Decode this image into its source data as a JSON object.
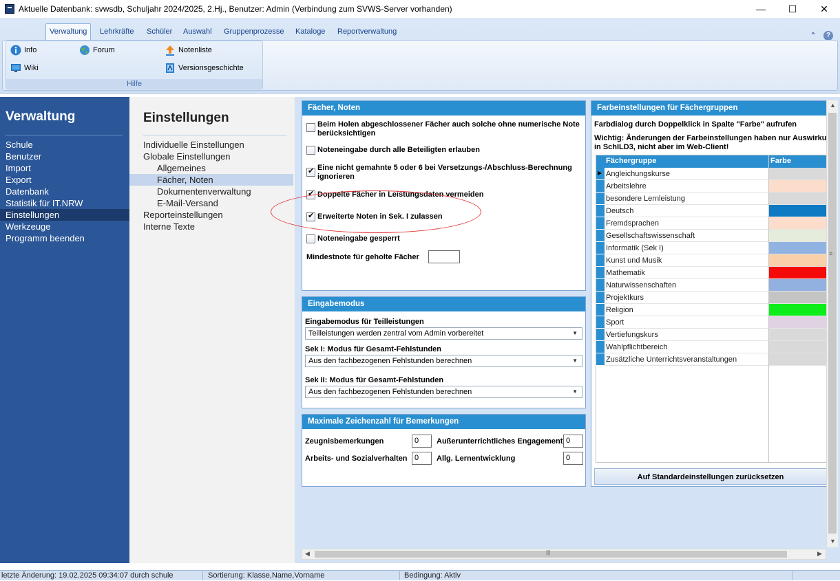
{
  "window": {
    "title": "Aktuelle Datenbank: svwsdb, Schuljahr 2024/2025, 2.Hj., Benutzer: Admin (Verbindung zum SVWS-Server vorhanden)",
    "minimize": "—",
    "maximize": "☐",
    "close": "✕"
  },
  "ribbon": {
    "tabs": [
      "Verwaltung",
      "Lehrkräfte",
      "Schüler",
      "Auswahl",
      "Gruppenprozesse",
      "Kataloge",
      "Reportverwaltung"
    ],
    "collapse": "⌃",
    "help": "?",
    "group_label": "Hilfe",
    "buttons": {
      "info": "Info",
      "forum": "Forum",
      "notenliste": "Notenliste",
      "wiki": "Wiki",
      "versionsgeschichte": "Versionsgeschichte"
    }
  },
  "leftnav": {
    "title": "Verwaltung",
    "items": [
      "Schule",
      "Benutzer",
      "Import",
      "Export",
      "Datenbank",
      "Statistik für IT.NRW",
      "Einstellungen",
      "Werkzeuge",
      "Programm beenden"
    ],
    "selected": "Einstellungen"
  },
  "settings": {
    "title": "Einstellungen",
    "items": [
      "Individuelle Einstellungen",
      "Globale Einstellungen",
      "Allgemeines",
      "Fächer, Noten",
      "Dokumentenverwaltung",
      "E-Mail-Versand",
      "Reporteinstellungen",
      "Interne Texte"
    ],
    "selected": "Fächer, Noten"
  },
  "faecher_noten": {
    "header": "Fächer, Noten",
    "checkboxes": [
      {
        "label_line1": "Beim Holen abgeschlossener Fächer auch solche ohne numerische Note",
        "label_line2": "berücksichtigen",
        "checked": false
      },
      {
        "label_line1": "Noteneingabe durch alle Beteiligten erlauben",
        "label_line2": "",
        "checked": false
      },
      {
        "label_line1": "Eine nicht gemahnte 5 oder 6 bei Versetzungs-/Abschluss-Berechnung",
        "label_line2": "ignorieren",
        "checked": true
      },
      {
        "label_line1": "Doppelte Fächer in Leistungsdaten vermeiden",
        "label_line2": "",
        "checked": true
      },
      {
        "label_line1": "Erweiterte Noten in Sek. I zulassen",
        "label_line2": "",
        "checked": true
      },
      {
        "label_line1": "Noteneingabe gesperrt",
        "label_line2": "",
        "checked": false
      }
    ],
    "mindestnote_label": "Mindestnote für geholte Fächer",
    "mindestnote_value": ""
  },
  "eingabemodus": {
    "header": "Eingabemodus",
    "teilleistungen_label": "Eingabemodus für Teilleistungen",
    "teilleistungen_value": "Teilleistungen werden zentral vom Admin vorbereitet",
    "sek1_label": "Sek I: Modus für Gesamt-Fehlstunden",
    "sek1_value": "Aus den fachbezogenen Fehlstunden berechnen",
    "sek2_label": "Sek II: Modus für Gesamt-Fehlstunden",
    "sek2_value": "Aus den fachbezogenen Fehlstunden berechnen",
    "arrow": "▼"
  },
  "zeichenzahl": {
    "header": "Maximale Zeichenzahl für Bemerkungen",
    "fields": [
      {
        "label": "Zeugnisbemerkungen",
        "value": "0"
      },
      {
        "label": "Außerunterrichtliches Engagement",
        "value": "0"
      },
      {
        "label": "Arbeits- und Sozialverhalten",
        "value": "0"
      },
      {
        "label": "Allg. Lernentwicklung",
        "value": "0"
      }
    ]
  },
  "farbeinstellungen": {
    "header": "Farbeinstellungen für Fächergruppen",
    "hint": "Farbdialog durch Doppelklick in Spalte \"Farbe\" aufrufen",
    "note_line1": "Wichtig: Änderungen der Farbeinstellungen haben nur Auswirku",
    "note_line2": "in SchILD3, nicht aber im Web-Client!",
    "col_name": "Fächergruppe",
    "col_color": "Farbe",
    "row_pointer": "▶",
    "rows": [
      {
        "name": "Angleichungskurse",
        "color": "#d9d9d9"
      },
      {
        "name": "Arbeitslehre",
        "color": "#fcdccb"
      },
      {
        "name": "besondere Lernleistung",
        "color": "#d9d9d9"
      },
      {
        "name": "Deutsch",
        "color": "#0f7ac4"
      },
      {
        "name": "Fremdsprachen",
        "color": "#fcdccb"
      },
      {
        "name": "Gesellschaftswissenschaft",
        "color": "#e6ecdc"
      },
      {
        "name": "Informatik (Sek I)",
        "color": "#91b3e2"
      },
      {
        "name": "Kunst und Musik",
        "color": "#f9d0aa"
      },
      {
        "name": "Mathematik",
        "color": "#f50a0a"
      },
      {
        "name": "Naturwissenschaften",
        "color": "#93b1e0"
      },
      {
        "name": "Projektkurs",
        "color": "#c4c4c4"
      },
      {
        "name": "Religion",
        "color": "#0ded1a"
      },
      {
        "name": "Sport",
        "color": "#e0d2e3"
      },
      {
        "name": "Vertiefungskurs",
        "color": "#d9d9d9"
      },
      {
        "name": "Wahlpflichtbereich",
        "color": "#d9d9d9"
      },
      {
        "name": "Zusätzliche Unterrichtsveranstaltungen",
        "color": "#d9d9d9"
      }
    ],
    "reset_button": "Auf Standardeinstellungen zurücksetzen"
  },
  "scroll": {
    "up": "▲",
    "down": "▼",
    "left": "◀",
    "right": "▶",
    "grip": "≡",
    "hgrip": "|||"
  },
  "statusbar": {
    "last_change": "letzte Änderung: 19.02.2025 09:34:07 durch schule",
    "sort": "Sortierung: Klasse,Name,Vorname",
    "condition": "Bedingung: Aktiv"
  }
}
